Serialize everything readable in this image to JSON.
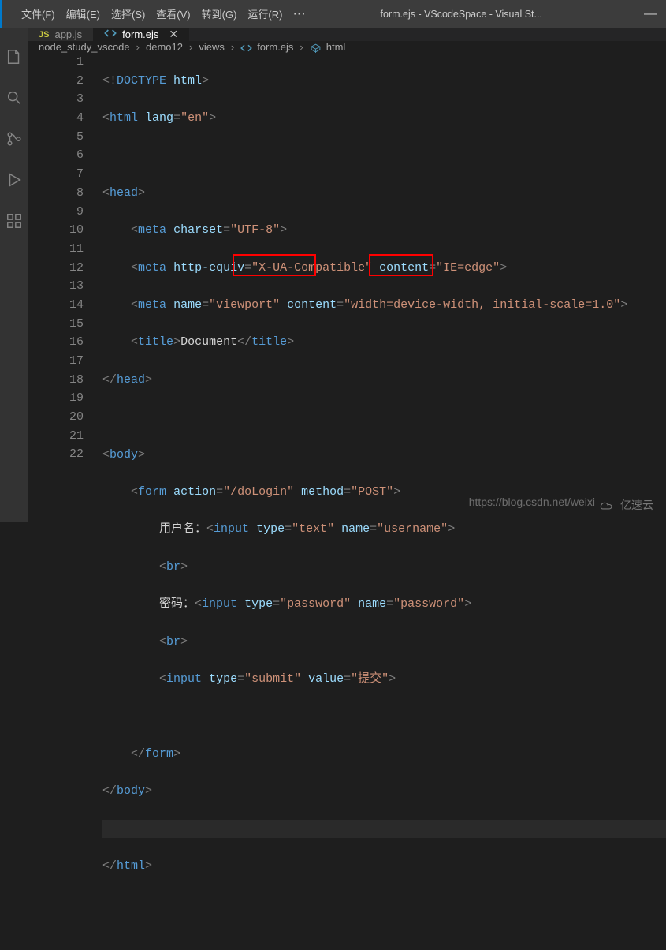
{
  "menubar": [
    "文件(F)",
    "编辑(E)",
    "选择(S)",
    "查看(V)",
    "转到(G)",
    "运行(R)",
    "···"
  ],
  "window_title": "form.ejs - VScodeSpace - Visual St...",
  "tabs": [
    {
      "icon": "JS",
      "label": "app.js",
      "active": false
    },
    {
      "icon": "<>",
      "label": "form.ejs",
      "active": true
    }
  ],
  "breadcrumbs": {
    "parts": [
      "node_study_vscode",
      "demo12",
      "views",
      "form.ejs",
      "html"
    ]
  },
  "lines": {
    "count": 22,
    "l1": {
      "i0": "<!",
      "dt": "DOCTYPE",
      "sp": " ",
      "ht": "html",
      "i1": ">"
    },
    "l2": {
      "attr": "lang",
      "val": "\"en\""
    },
    "l5": {
      "attr": "charset",
      "val": "\"UTF-8\""
    },
    "l6": {
      "a1": "http-equiv",
      "v1": "\"X-UA-Compatible\"",
      "a2": "content",
      "v2": "\"IE=edge\""
    },
    "l7": {
      "a1": "name",
      "v1": "\"viewport\"",
      "a2": "content",
      "v2": "\"width=device-width, initial-scale=1.0\""
    },
    "l8": {
      "txt": "Document"
    },
    "l12": {
      "a1": "action",
      "v1": "\"/doLogin\"",
      "a2": "method",
      "v2": "\"POST\""
    },
    "l13": {
      "lbl": "用户名：",
      "a1": "type",
      "v1": "\"text\"",
      "a2": "name",
      "v2": "\"username\""
    },
    "l15": {
      "lbl": "密码：",
      "a1": "type",
      "v1": "\"password\"",
      "a2": "name",
      "v2": "\"password\""
    },
    "l17": {
      "a1": "type",
      "v1": "\"submit\"",
      "a2": "value",
      "v2": "\"提交\""
    }
  },
  "tags": {
    "html": "html",
    "head": "head",
    "meta": "meta",
    "title": "title",
    "body": "body",
    "form": "form",
    "input": "input",
    "br": "br"
  },
  "watermark": "https://blog.csdn.net/weixi",
  "yisu": "亿速云"
}
